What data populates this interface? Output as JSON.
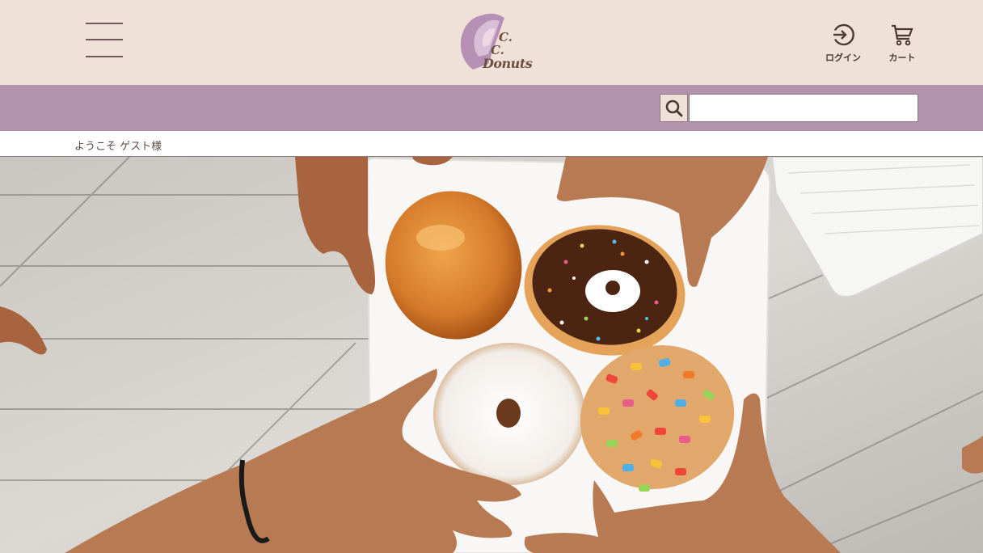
{
  "header": {
    "logo": {
      "line1": "C.",
      "line2": "C.",
      "line3": "Donuts"
    },
    "login_label": "ログイン",
    "cart_label": "カート"
  },
  "search": {
    "value": "",
    "placeholder": ""
  },
  "welcome": {
    "text": "ようこそ ゲスト様"
  },
  "colors": {
    "header_bg": "#efe1d8",
    "search_bar_bg": "#b193ae",
    "logo_arc_outer": "#b690b4",
    "logo_arc_middle": "#d9bfd6",
    "logo_arc_inner": "#efd8e6",
    "text_brown": "#4a3a33"
  },
  "icons": {
    "menu": "hamburger-menu-icon",
    "login": "login-icon",
    "cart": "cart-icon",
    "search": "search-icon"
  }
}
